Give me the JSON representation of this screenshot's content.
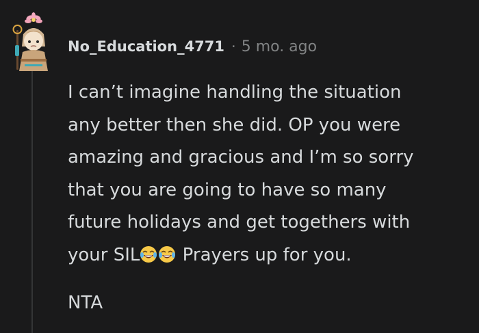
{
  "comment": {
    "username": "No_Education_4771",
    "separator": "·",
    "timestamp": "5 mo. ago",
    "body_lines": [
      "I can’t imagine handling the situation",
      "any better then she did. OP you were",
      "amazing and gracious and I’m so sorry",
      "that you are going to have so many",
      "future holidays and get togethers with"
    ],
    "last_line_before": "your SIL",
    "last_line_after": " Prayers up for you.",
    "emojis": [
      "face-with-tears-of-joy-icon",
      "face-with-tears-of-joy-icon"
    ],
    "verdict": "NTA"
  },
  "colors": {
    "background": "#1a1a1b",
    "text": "#d7dadc",
    "meta": "#818384",
    "thread_line": "#343536"
  }
}
